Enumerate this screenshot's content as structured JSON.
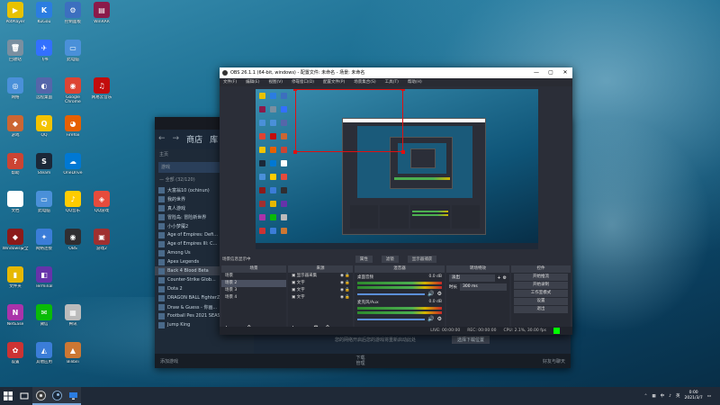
{
  "desktop": {
    "icons": [
      {
        "label": "PotPlayer",
        "color": "#e8c200",
        "glyph": "▶"
      },
      {
        "label": "KuGou",
        "color": "#2b7de1",
        "glyph": "K"
      },
      {
        "label": "控制面板",
        "color": "#3c6fbf",
        "glyph": "⚙"
      },
      {
        "label": "WinRAR",
        "color": "#8b1a4a",
        "glyph": "▤"
      },
      {
        "label": "回收站",
        "color": "#7a8fa0",
        "glyph": "🗑"
      },
      {
        "label": "飞书",
        "color": "#3370ff",
        "glyph": "✈"
      },
      {
        "label": "此电脑",
        "color": "#4a90d9",
        "glyph": "▭"
      },
      {
        "label": "网络",
        "color": "#4a90d9",
        "glyph": "◎"
      },
      {
        "label": "远程桌面",
        "color": "#5566aa",
        "glyph": "◐"
      },
      {
        "label": "Google Chrome",
        "color": "#dd4433",
        "glyph": "◉"
      },
      {
        "label": "网易云音乐",
        "color": "#c20c0c",
        "glyph": "♫"
      },
      {
        "label": "游戏",
        "color": "#cc6633",
        "glyph": "◆"
      },
      {
        "label": "QQ",
        "color": "#f4c300",
        "glyph": "Q"
      },
      {
        "label": "Firefox",
        "color": "#e66000",
        "glyph": "◕"
      },
      {
        "label": "帮助",
        "color": "#cc4433",
        "glyph": "?"
      },
      {
        "label": "Steam",
        "color": "#1b2838",
        "glyph": "S"
      },
      {
        "label": "OneDrive",
        "color": "#0078d4",
        "glyph": "☁"
      },
      {
        "label": "文档",
        "color": "#ffffff",
        "glyph": "▯"
      },
      {
        "label": "此电脑",
        "color": "#4a90d9",
        "glyph": "▭"
      },
      {
        "label": "QQ音乐",
        "color": "#ffcc00",
        "glyph": "♪"
      },
      {
        "label": "QQ游戏",
        "color": "#e64b3c",
        "glyph": "◈"
      },
      {
        "label": "Windows安全",
        "color": "#8b1a1a",
        "glyph": "◆"
      },
      {
        "label": "网络连接",
        "color": "#3b7dd8",
        "glyph": "✦"
      },
      {
        "label": "OBS",
        "color": "#302e31",
        "glyph": "◉"
      },
      {
        "label": "游戏2",
        "color": "#a03030",
        "glyph": "▣"
      },
      {
        "label": "文件夹",
        "color": "#e6b800",
        "glyph": "▮"
      },
      {
        "label": "Terminal",
        "color": "#6633aa",
        "glyph": "◧"
      },
      {
        "label": "NetEase",
        "color": "#aa33aa",
        "glyph": "N"
      },
      {
        "label": "微信",
        "color": "#09bb07",
        "glyph": "✉"
      },
      {
        "label": "腾讯",
        "color": "#bbb",
        "glyph": "▦"
      },
      {
        "label": "设置",
        "color": "#cc3333",
        "glyph": "✿"
      },
      {
        "label": "其他应用",
        "color": "#3b7dd8",
        "glyph": "◭"
      },
      {
        "label": "Bilibili",
        "color": "#cc7733",
        "glyph": "▲"
      },
      {
        "label": "软件",
        "color": "#3b7dd8",
        "glyph": "◆"
      }
    ]
  },
  "steam": {
    "nav_store": "商店",
    "nav_library": "库",
    "home": "主页",
    "filter": "游戏",
    "group_header": "— 全部 (32/120)",
    "games": [
      "大富翁10 (ochinun)",
      "我的世界",
      "真人游戏",
      "冒险岛: 冒险新世界",
      "小小梦魇2",
      "Age of Empires: Defi...",
      "Age of Empires III: C...",
      "Among Us",
      "Apex Legends",
      "Back 4 Blood Beta",
      "Counter-Strike Glob...",
      "Dota 2",
      "DRAGON BALL FighterZ",
      "Draw & Guess - 你画...",
      "Football Pes 2021 SEASON UPDATE",
      "Jump King"
    ],
    "selected_game": 9,
    "bottom_left": "添加游戏",
    "bottom_center": "下载",
    "bottom_center_sub": "管理",
    "bottom_right": "好友与聊天",
    "notice": "您的网络开启后您的游戏将重新启动此处",
    "notice_btn": "选择下载位置"
  },
  "obs": {
    "title": "OBS 26.1.1 (64-bit, windows) - 配置文件: 未命名 - 场景: 未命名",
    "menu": [
      "文件(F)",
      "编辑(E)",
      "视图(V)",
      "停靠窗口(D)",
      "配置文件(P)",
      "场景集合(S)",
      "工具(T)",
      "帮助(H)"
    ],
    "current_scene_label": "场景信息显示中",
    "status_buttons": [
      "属性",
      "滤镜",
      "显示器捕获"
    ],
    "docks": {
      "scenes": {
        "title": "场景",
        "items": [
          "场景",
          "场景 2",
          "场景 3",
          "场景 4"
        ],
        "selected": 1
      },
      "sources": {
        "title": "来源",
        "items": [
          "显示器采集",
          "文字",
          "文字",
          "文字"
        ]
      },
      "mixer": {
        "title": "混音器",
        "channels": [
          "桌面音频",
          "麦克风/Aux"
        ],
        "levels": [
          "0.0 dB",
          "0.0 dB"
        ]
      },
      "transitions": {
        "title": "转场特效",
        "type": "淡出",
        "duration_label": "时长",
        "duration": "300 ms"
      },
      "controls": {
        "title": "控件",
        "buttons": [
          "开始推流",
          "开始录制",
          "工作室模式",
          "设置",
          "退出"
        ]
      }
    },
    "statusbar": {
      "live": "LIVE: 00:00:00",
      "rec": "REC: 00:00:00",
      "cpu": "CPU: 2.1%, 30.00 fps"
    }
  },
  "taskbar": {
    "time": "0:00",
    "date": "2021/3/7",
    "ime": "中",
    "lang": "英"
  }
}
